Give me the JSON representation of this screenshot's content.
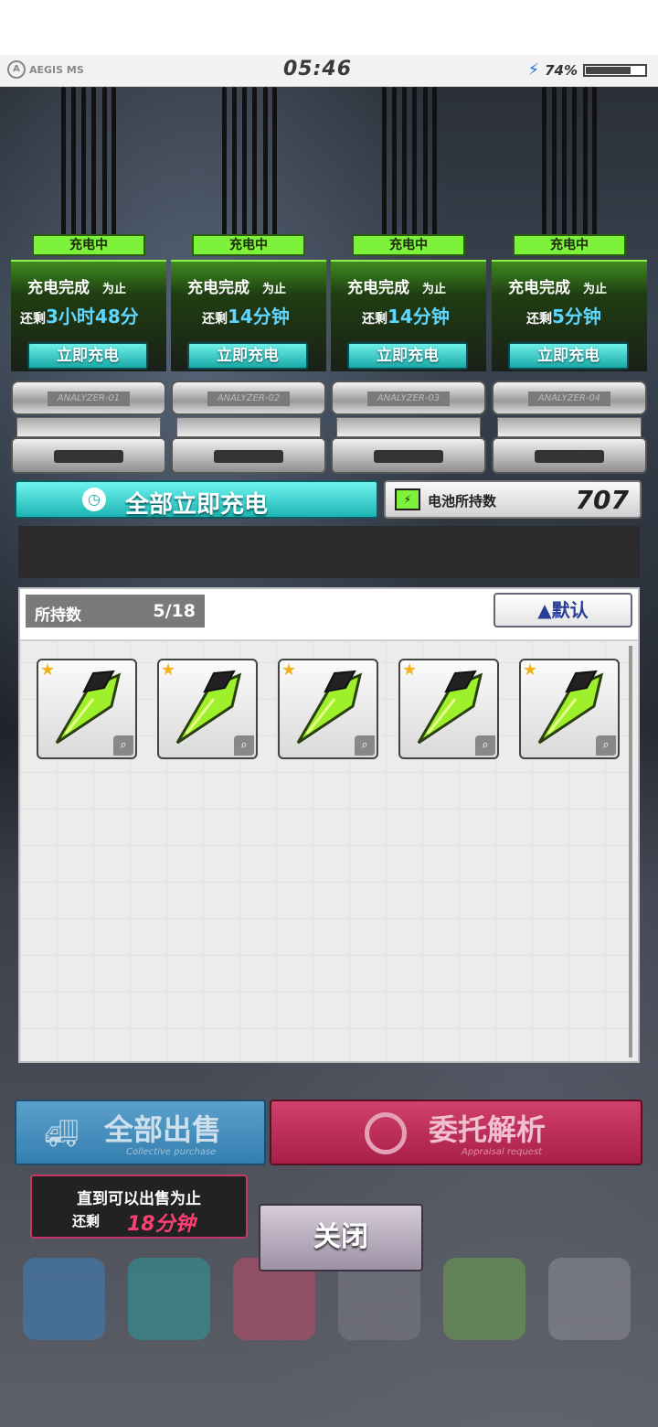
{
  "status_bar": {
    "logo_text": "AEGIS MS",
    "time": "05:46",
    "battery_percent": "74%",
    "battery_level": 0.74
  },
  "analyzers": [
    {
      "status": "充电中",
      "line1": "充电完成",
      "line1_suffix": "为止",
      "remaining_prefix": "还剩",
      "remaining": "3小时48分",
      "charge_button": "立即充电",
      "plate": "ANALYZER-01"
    },
    {
      "status": "充电中",
      "line1": "充电完成",
      "line1_suffix": "为止",
      "remaining_prefix": "还剩",
      "remaining": "14分钟",
      "charge_button": "立即充电",
      "plate": "ANALYZER-02"
    },
    {
      "status": "充电中",
      "line1": "充电完成",
      "line1_suffix": "为止",
      "remaining_prefix": "还剩",
      "remaining": "14分钟",
      "charge_button": "立即充电",
      "plate": "ANALYZER-03"
    },
    {
      "status": "充电中",
      "line1": "充电完成",
      "line1_suffix": "为止",
      "remaining_prefix": "还剩",
      "remaining": "5分钟",
      "charge_button": "立即充电",
      "plate": "ANALYZER-04"
    }
  ],
  "charge_all": {
    "label": "全部立即充电",
    "icon": "clock-icon"
  },
  "battery_count": {
    "label": "电池所持数",
    "value": "707",
    "icon": "battery-icon"
  },
  "inventory": {
    "held_label": "所持数",
    "held_value": "5/18",
    "sort_label": "▲默认",
    "items": [
      {
        "name": "green-shell-item",
        "rarity": 1
      },
      {
        "name": "green-shell-item",
        "rarity": 1
      },
      {
        "name": "green-shell-item",
        "rarity": 1
      },
      {
        "name": "green-shell-item",
        "rarity": 1
      },
      {
        "name": "green-shell-item",
        "rarity": 1
      }
    ]
  },
  "sell_all": {
    "label": "全部出售",
    "sub": "Collective purchase",
    "icon": "truck-icon"
  },
  "delegate": {
    "label": "委托解析",
    "sub": "Appraisal request",
    "icon": "ring-icon"
  },
  "sell_tip": {
    "line1": "直到可以出售为止",
    "prefix": "还剩",
    "time": "18分钟"
  },
  "close_button": "关闭",
  "colors": {
    "charging_green": "#7df23a",
    "cyan": "#1db4b2",
    "pink": "#c8306a",
    "remaining_blue": "#5fd6ff"
  }
}
